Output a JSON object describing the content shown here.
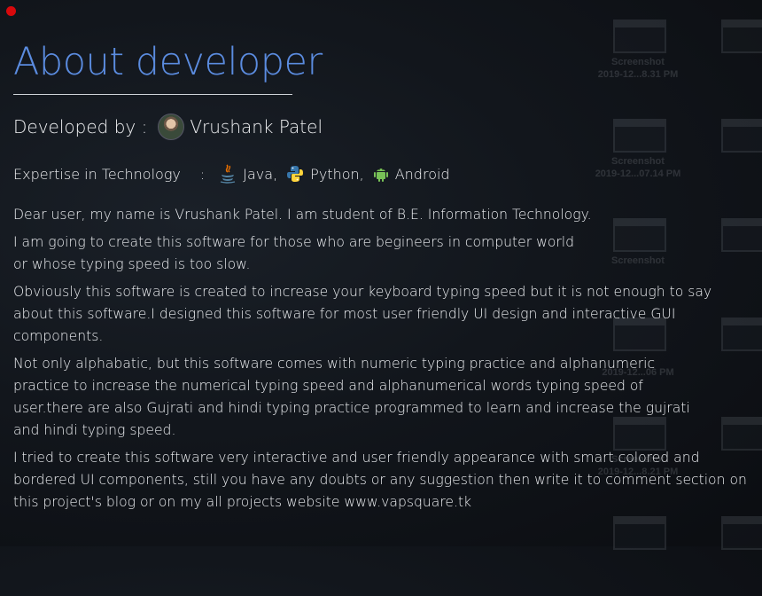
{
  "window": {
    "close_button_color": "#d8090c"
  },
  "header": {
    "title": "About developer"
  },
  "developer": {
    "label": "Developed by :",
    "name": "Vrushank Patel"
  },
  "expertise": {
    "label": "Expertise in Technology",
    "separator": ":",
    "items": [
      {
        "icon": "java-icon",
        "label": "Java,"
      },
      {
        "icon": "python-icon",
        "label": "Python,"
      },
      {
        "icon": "android-icon",
        "label": "Android"
      }
    ]
  },
  "paragraphs": [
    "Dear user, my name is Vrushank Patel. I am student of B.E. Information Technology.",
    "I am going to create this software for those who are begineers in computer world or whose typing speed is too slow.",
    "Obviously this software is created to increase your keyboard typing speed but it is not enough to say about this software.I designed this software for most user friendly UI design and interactive GUI components.",
    "Not only alphabatic, but this software comes with numeric typing practice and alphanumeric practice to increase the numerical typing speed and alphanumerical words typing speed of user.there are also Gujrati and hindi typing practice programmed to learn and increase the gujrati and hindi typing speed.",
    "I tried to create this software very interactive and user friendly appearance with smart colored and bordered UI components, still you have any doubts or any suggestion then write it to comment section on this project's blog or on my all projects website www.vapsquare.tk"
  ],
  "desktop_icons": [
    {
      "caption": "Screenshot",
      "time": "2019-12...8.31 PM"
    },
    {
      "caption": "Screenshot",
      "time": "2019-12...07.14 PM"
    },
    {
      "caption": "Screenshot",
      "time": "2019-12...06 PM"
    },
    {
      "caption": "Screenshot",
      "time": "2019-12...8.21 PM"
    }
  ]
}
